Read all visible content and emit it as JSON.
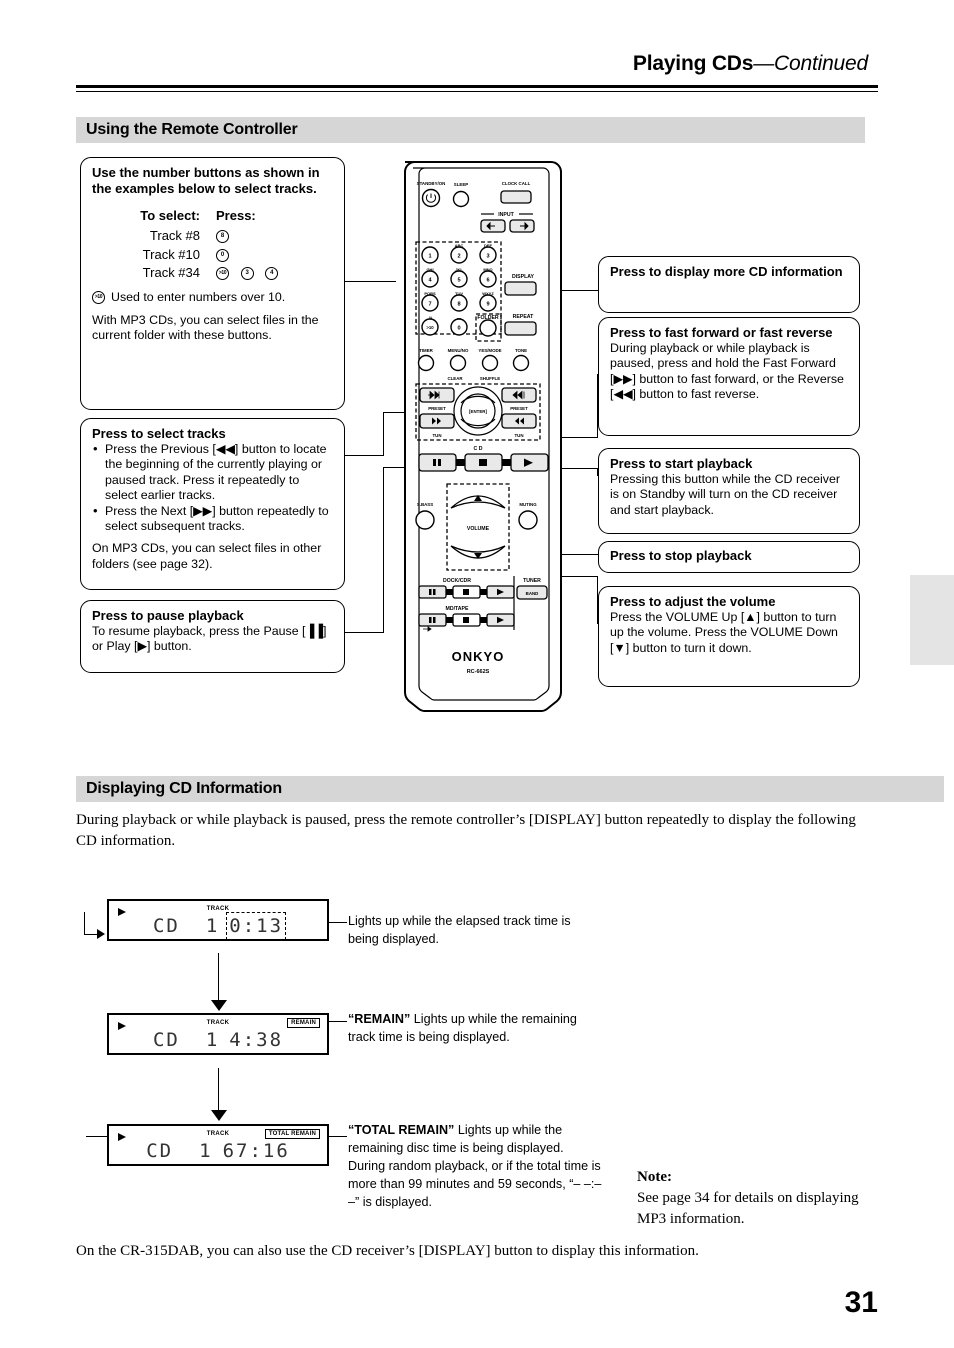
{
  "header": {
    "title_main": "Playing CDs",
    "title_cont": "—Continued"
  },
  "sections": {
    "remote": "Using the Remote Controller",
    "display": "Displaying CD Information"
  },
  "number_box": {
    "heading": "Use the number buttons as shown in the examples below to select tracks.",
    "col_select": "To select:",
    "col_press": "Press:",
    "rows": [
      {
        "label": "Track #8",
        "buttons": [
          "8"
        ]
      },
      {
        "label": "Track #10",
        "buttons": [
          "0"
        ]
      },
      {
        "label": "Track #34",
        "buttons": [
          ">10",
          "3",
          "4"
        ]
      }
    ],
    "over10_icon": ">10",
    "over10_note": "Used to enter numbers over 10.",
    "mp3_note": "With MP3 CDs, you can select files in the current folder with these buttons."
  },
  "select_tracks_box": {
    "heading": "Press to select tracks",
    "bullet1": "Press the Previous [◀◀] button to locate the beginning of the currently playing or paused track. Press it repeatedly to select earlier tracks.",
    "bullet2": "Press the Next [▶▶] button repeatedly to select subsequent tracks.",
    "body": "On MP3 CDs, you can select files in other folders (see page 32)."
  },
  "pause_box": {
    "heading": "Press to pause playback",
    "body": "To resume playback, press the Pause [▐▐] or Play [▶] button."
  },
  "display_info_box": {
    "heading": "Press to display more CD information"
  },
  "fast_forward_box": {
    "heading": "Press to fast forward or fast reverse",
    "body": "During playback or while playback is paused, press and hold the Fast Forward [▶▶] button to fast forward, or the Reverse [◀◀] button to fast reverse."
  },
  "start_box": {
    "heading": "Press to start playback",
    "body": "Pressing this button while the CD receiver is on Standby will turn on the CD receiver and start playback."
  },
  "stop_box": {
    "heading": "Press to stop playback"
  },
  "volume_box": {
    "heading": "Press to adjust the volume",
    "body": "Press the VOLUME Up [▲] button to turn up the volume. Press the VOLUME Down [▼] button to turn it down."
  },
  "remote_labels": {
    "standby": "STANDBY/ON",
    "sleep": "SLEEP",
    "clock_call": "CLOCK CALL",
    "input": "INPUT",
    "display": "DISPLAY",
    "repeat": "REPEAT",
    "folder": "FOLDER",
    "timer": "TIMER",
    "menu_no": "MENU/NO",
    "yes_mode": "YES/MODE",
    "tone": "TONE",
    "clear": "CLEAR",
    "shuffle": "SHUFFLE",
    "preset_l": "PRESET",
    "preset_r": "PRESET",
    "enter": "ENTER",
    "tun_l": "TUN",
    "tun_r": "TUN",
    "cd": "C D",
    "s_bass": "S.BASS",
    "muting": "MUTING",
    "volume": "VOLUME",
    "dock_cdr": "DOCK/CDR",
    "tuner": "TUNER",
    "band": "BAND",
    "md_tape": "MD/TAPE",
    "brand": "ONKYO",
    "model": "RC-662S",
    "keys": [
      {
        "num": "1",
        "alpha": ""
      },
      {
        "num": "2",
        "alpha": "ABC"
      },
      {
        "num": "3",
        "alpha": "DEF"
      },
      {
        "num": "4",
        "alpha": "GHI"
      },
      {
        "num": "5",
        "alpha": "JKL"
      },
      {
        "num": "6",
        "alpha": "MNO"
      },
      {
        "num": "7",
        "alpha": "PQRS"
      },
      {
        "num": "8",
        "alpha": "TUV"
      },
      {
        "num": "9",
        "alpha": "WXYZ"
      },
      {
        "num": ">10",
        "alpha": "./#"
      },
      {
        "num": "0",
        "alpha": "—"
      }
    ]
  },
  "display_section": {
    "intro": "During playback or while playback is paused, press the remote controller’s [DISPLAY] button repeatedly to display the following CD information.",
    "footer": "On the CR-315DAB, you can also use the CD receiver’s [DISPLAY] button to display this information."
  },
  "lcds": [
    {
      "track_label": "TRACK",
      "indicator": "",
      "source": "CD",
      "track_no": "1",
      "time": "0:13",
      "caption_title": "",
      "caption_body": "Lights up while the elapsed track time is being displayed."
    },
    {
      "track_label": "TRACK",
      "indicator": "REMAIN",
      "source": "CD",
      "track_no": "1",
      "time": "4:38",
      "caption_title": "“REMAIN”",
      "caption_body": "Lights up while the remaining track time is being displayed."
    },
    {
      "track_label": "TRACK",
      "indicator": "TOTAL REMAIN",
      "source": "CD",
      "track_no": "1",
      "time": "67:16",
      "caption_title": "“TOTAL REMAIN”",
      "caption_body": "Lights up while the remaining disc time is being displayed. During random playback, or if the total time is more than 99 minutes and 59 seconds, “– –:– –” is displayed."
    }
  ],
  "note": {
    "title": "Note:",
    "body": "See page 34 for details on displaying MP3 information."
  },
  "page_number": "31"
}
